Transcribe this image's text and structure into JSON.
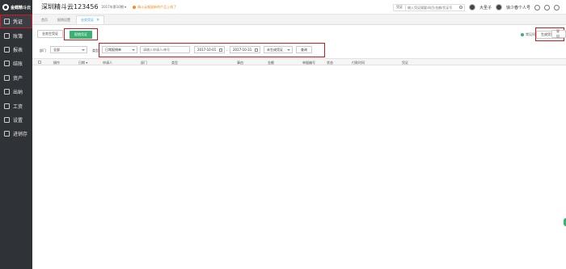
{
  "app": {
    "logo_text": "金蝶精斗云"
  },
  "sidebar": {
    "items": [
      {
        "label": "凭证",
        "icon": "voucher-icon",
        "active": true
      },
      {
        "label": "账簿",
        "icon": "ledger-icon"
      },
      {
        "label": "报表",
        "icon": "report-icon"
      },
      {
        "label": "结账",
        "icon": "close-account-icon"
      },
      {
        "label": "资产",
        "icon": "asset-icon"
      },
      {
        "label": "出纳",
        "icon": "cashier-icon"
      },
      {
        "label": "工资",
        "icon": "salary-icon"
      },
      {
        "label": "设置",
        "icon": "gear-icon"
      },
      {
        "label": "进销存",
        "icon": "inventory-icon"
      }
    ]
  },
  "header": {
    "company": "深圳精斗云123456",
    "period": "2017年第10期 ▾",
    "notice": "精斗云報展新的产品上线了",
    "search": {
      "type": "凭证",
      "placeholder": "输入凭证摘要/科目/金额/凭证号"
    },
    "user_name": "大圣子",
    "personal_center": "徐少春个人号"
  },
  "tabs": [
    {
      "label": "首页"
    },
    {
      "label": "报销设置"
    },
    {
      "label": "业务凭证",
      "active": true,
      "close": "×"
    }
  ],
  "actions": {
    "generate_voucher_label": "业务生凭证",
    "reimburse_voucher_label": "报销凭证",
    "help_label": "常见问题",
    "create_voucher_label": "生成凭证",
    "export_label": "导出"
  },
  "filters": {
    "dept_label": "部门",
    "dept_value": "全部",
    "type_label": "类型",
    "type_value": "日常报销单",
    "applicant_placeholder": "请输入申请人/单号",
    "date_from": "2017-10-01",
    "date_to": "2017-10-31",
    "status_value": "未生成凭证",
    "query_label": "查询"
  },
  "table": {
    "columns": [
      "操作",
      "日期 ▾",
      "申请人",
      "部门",
      "类型",
      "事由",
      "金额",
      "单据编号",
      "状态",
      "付款时间",
      "凭证"
    ]
  },
  "colors": {
    "accent": "#3cb071",
    "highlight": "#d0191f",
    "sidebar": "#2f3237",
    "tab_active": "#27a3d8"
  }
}
